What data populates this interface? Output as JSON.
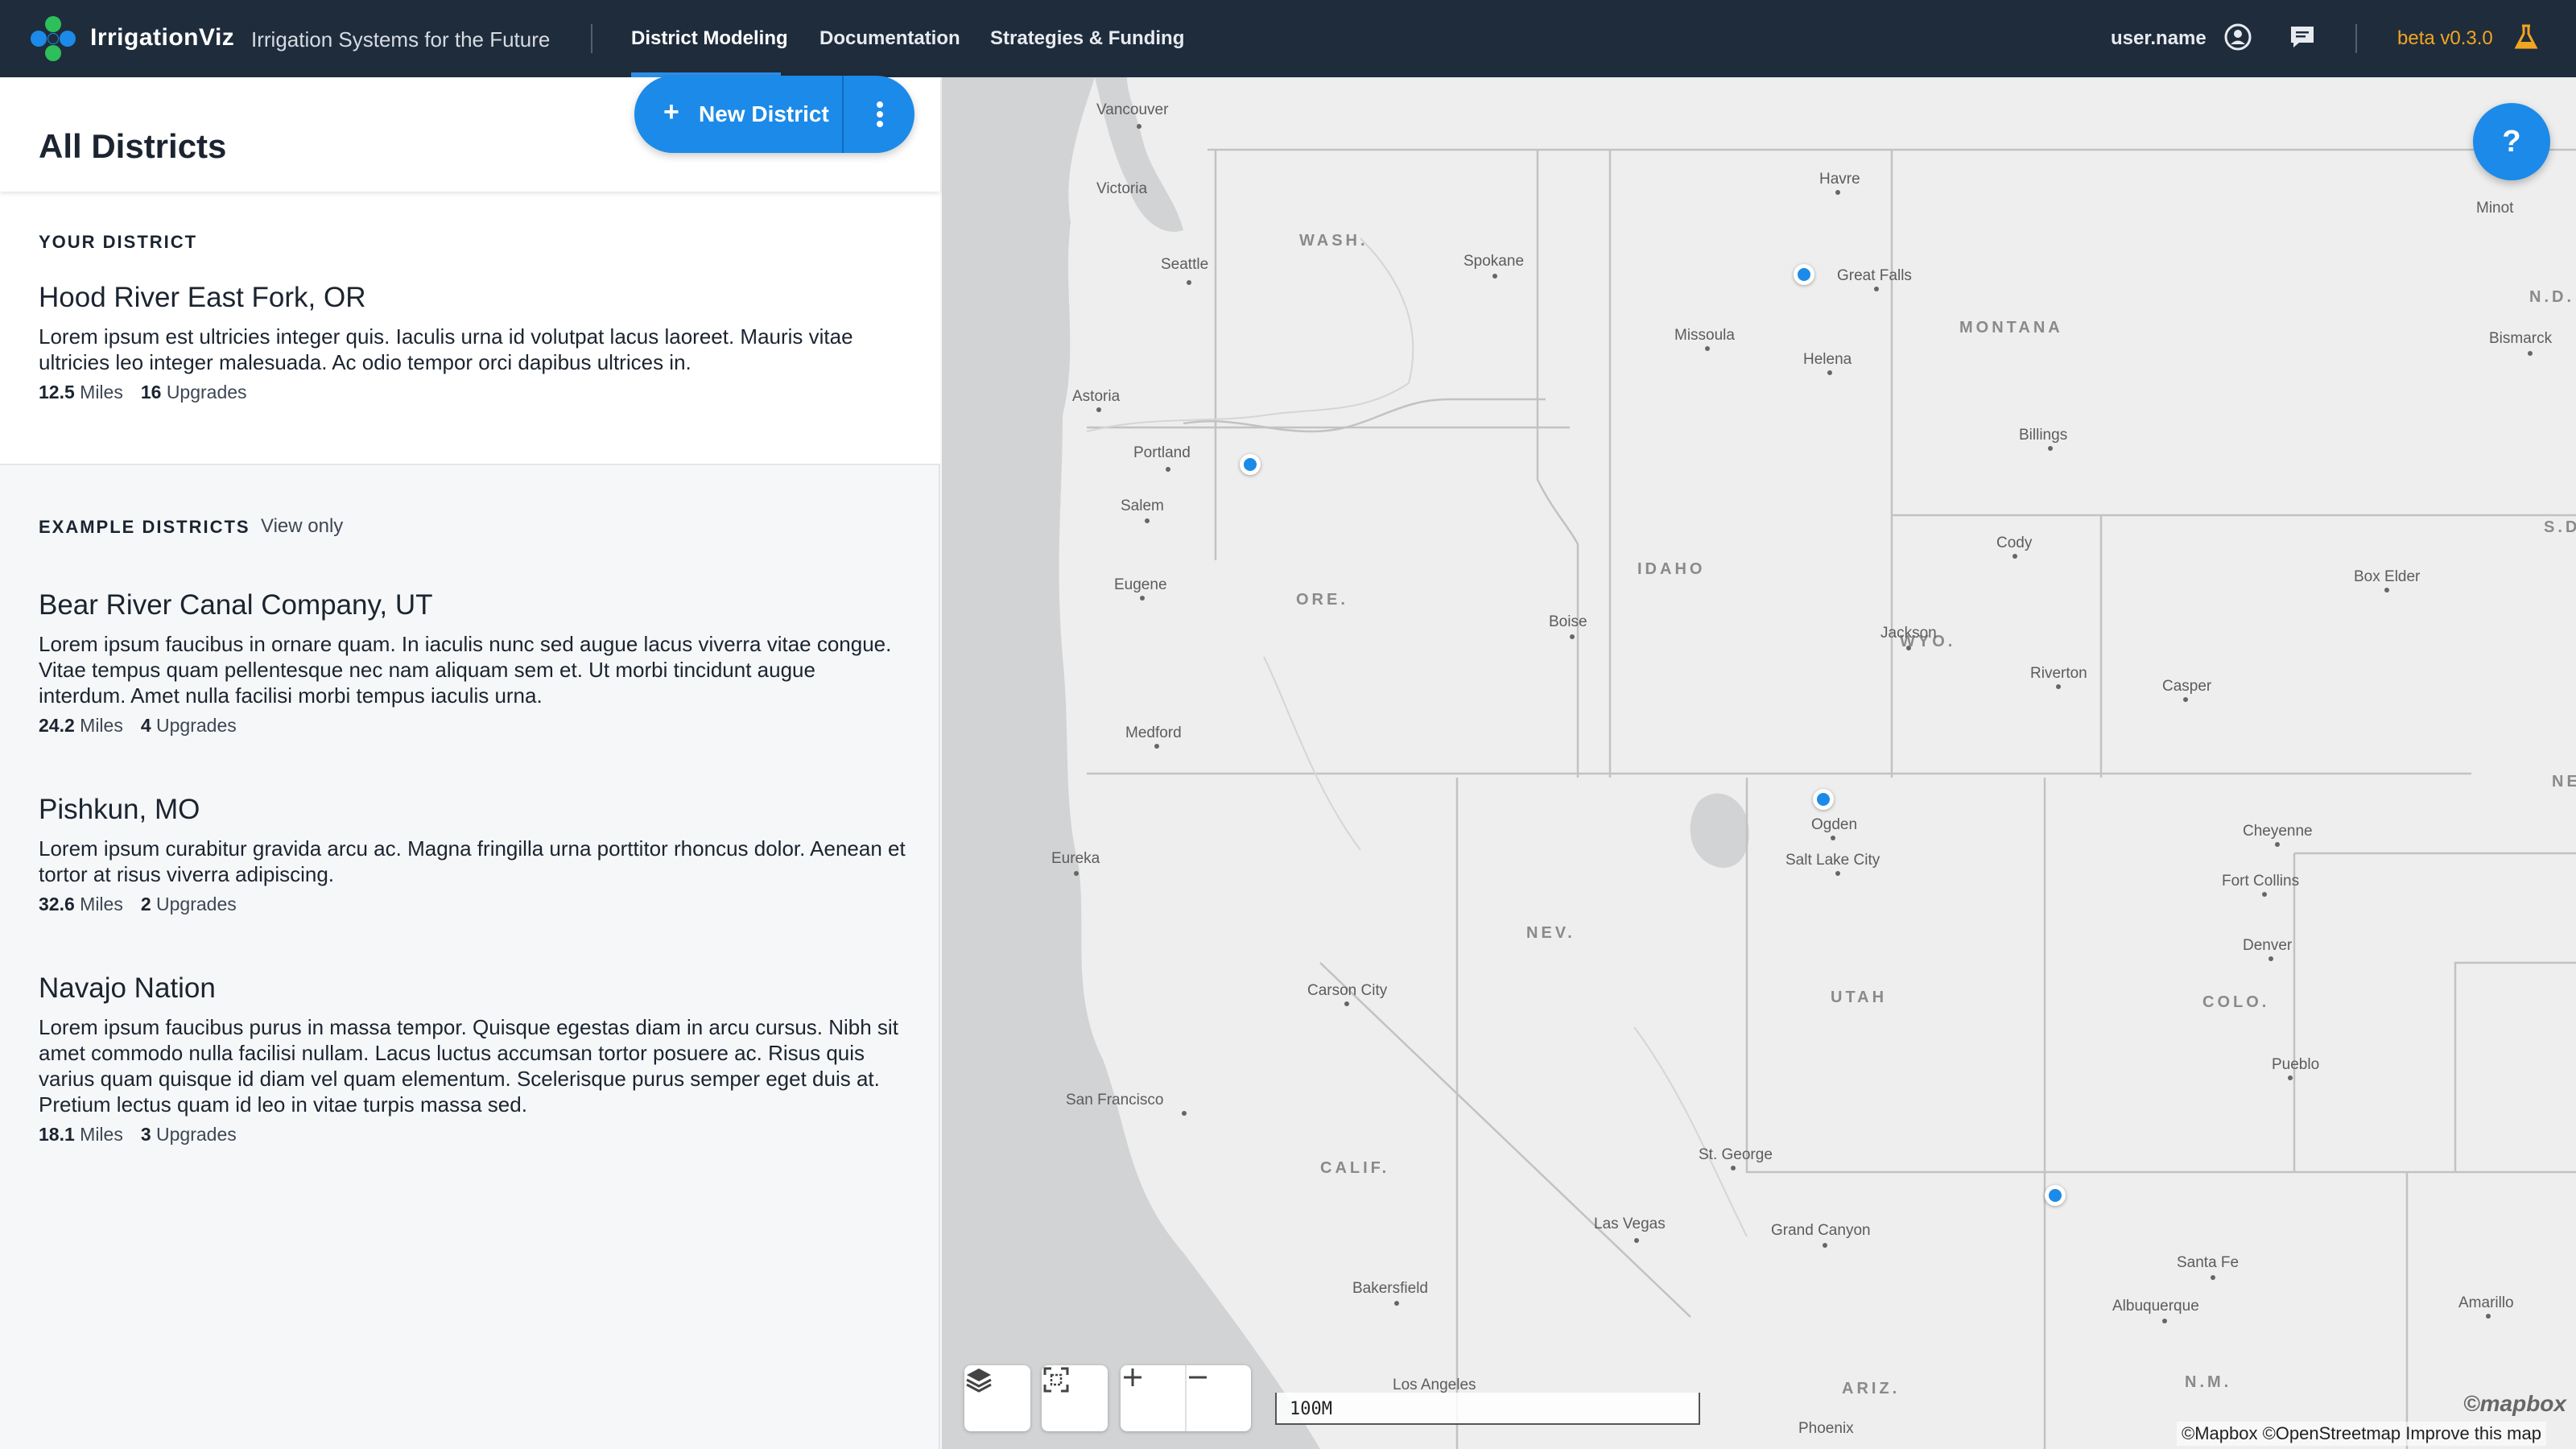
{
  "header": {
    "app_name": "IrrigationViz",
    "tagline": "Irrigation Systems for the Future",
    "tabs": [
      {
        "label": "District Modeling",
        "active": true
      },
      {
        "label": "Documentation",
        "active": false
      },
      {
        "label": "Strategies & Funding",
        "active": false
      }
    ],
    "user_name": "user.name",
    "version": "beta v0.3.0",
    "icons": {
      "user": "user-circle-icon",
      "chat": "chat-bubble-icon",
      "beta": "flask-icon",
      "logo": "flower-logo-icon"
    }
  },
  "sidebar": {
    "title": "All Districts",
    "new_district_label": "New District",
    "your_district_label": "YOUR DISTRICT",
    "your_district": {
      "name": "Hood River East Fork, OR",
      "description": "Lorem ipsum est ultricies integer quis. Iaculis urna id volutpat lacus laoreet. Mauris vitae ultricies leo integer malesuada. Ac odio tempor orci dapibus ultrices in.",
      "miles": "12.5",
      "miles_label": "Miles",
      "upgrades": "16",
      "upgrades_label": "Upgrades"
    },
    "example_label": "EXAMPLE DISTRICTS",
    "view_only_label": "View only",
    "examples": [
      {
        "name": "Bear River Canal Company, UT",
        "description": "Lorem ipsum faucibus in ornare quam. In iaculis nunc sed augue lacus viverra vitae congue. Vitae tempus quam pellentesque nec nam aliquam sem et. Ut morbi tincidunt augue interdum. Amet nulla facilisi morbi tempus iaculis urna.",
        "miles": "24.2",
        "miles_label": "Miles",
        "upgrades": "4",
        "upgrades_label": "Upgrades"
      },
      {
        "name": "Pishkun, MO",
        "description": "Lorem ipsum curabitur gravida arcu ac. Magna fringilla urna porttitor rhoncus dolor. Aenean et tortor at risus viverra adipiscing.",
        "miles": "32.6",
        "miles_label": "Miles",
        "upgrades": "2",
        "upgrades_label": "Upgrades"
      },
      {
        "name": "Navajo Nation",
        "description": "Lorem ipsum faucibus purus in massa tempor. Quisque egestas diam in arcu cursus. Nibh sit amet commodo nulla facilisi nullam. Lacus luctus accumsan tortor posuere ac. Risus quis varius quam quisque id diam vel quam elementum. Scelerisque purus semper eget duis at. Pretium lectus quam id leo in vitae turpis massa sed.",
        "miles": "18.1",
        "miles_label": "Miles",
        "upgrades": "3",
        "upgrades_label": "Upgrades"
      }
    ]
  },
  "map": {
    "help_label": "?",
    "scale_label": "100M",
    "attribution": "©Mapbox ©OpenStreetmap Improve this map",
    "logo_text": "©mapbox",
    "states": [
      "WASH.",
      "MONTANA",
      "N.D.",
      "S.D.",
      "IDAHO",
      "ORE.",
      "WYO.",
      "NE",
      "NEV.",
      "UTAH",
      "COLO.",
      "CALIF.",
      "ARIZ.",
      "N.M."
    ],
    "cities": [
      "Vancouver",
      "Victoria",
      "Seattle",
      "Spokane",
      "Havre",
      "Minot",
      "Great Falls",
      "Missoula",
      "Helena",
      "Bismarck",
      "Astoria",
      "Portland",
      "Salem",
      "Billings",
      "Cody",
      "Eugene",
      "Boise",
      "Jackson",
      "Box Elder",
      "Riverton",
      "Casper",
      "Medford",
      "Ogden",
      "Salt Lake City",
      "Cheyenne",
      "Eureka",
      "Fort Collins",
      "Denver",
      "Carson City",
      "Pueblo",
      "San Francisco",
      "St. George",
      "Las Vegas",
      "Grand Canyon",
      "Santa Fe",
      "Albuquerque",
      "Amarillo",
      "Bakersfield",
      "Los Angeles",
      "Phoenix"
    ],
    "controls": {
      "layers": "layers-icon",
      "fit": "fit-bounds-icon",
      "zoom_in": "plus-icon",
      "zoom_out": "minus-icon"
    }
  },
  "colors": {
    "accent": "#1c8ae8",
    "header_bg": "#1f2c3c",
    "version": "#f2a521"
  }
}
